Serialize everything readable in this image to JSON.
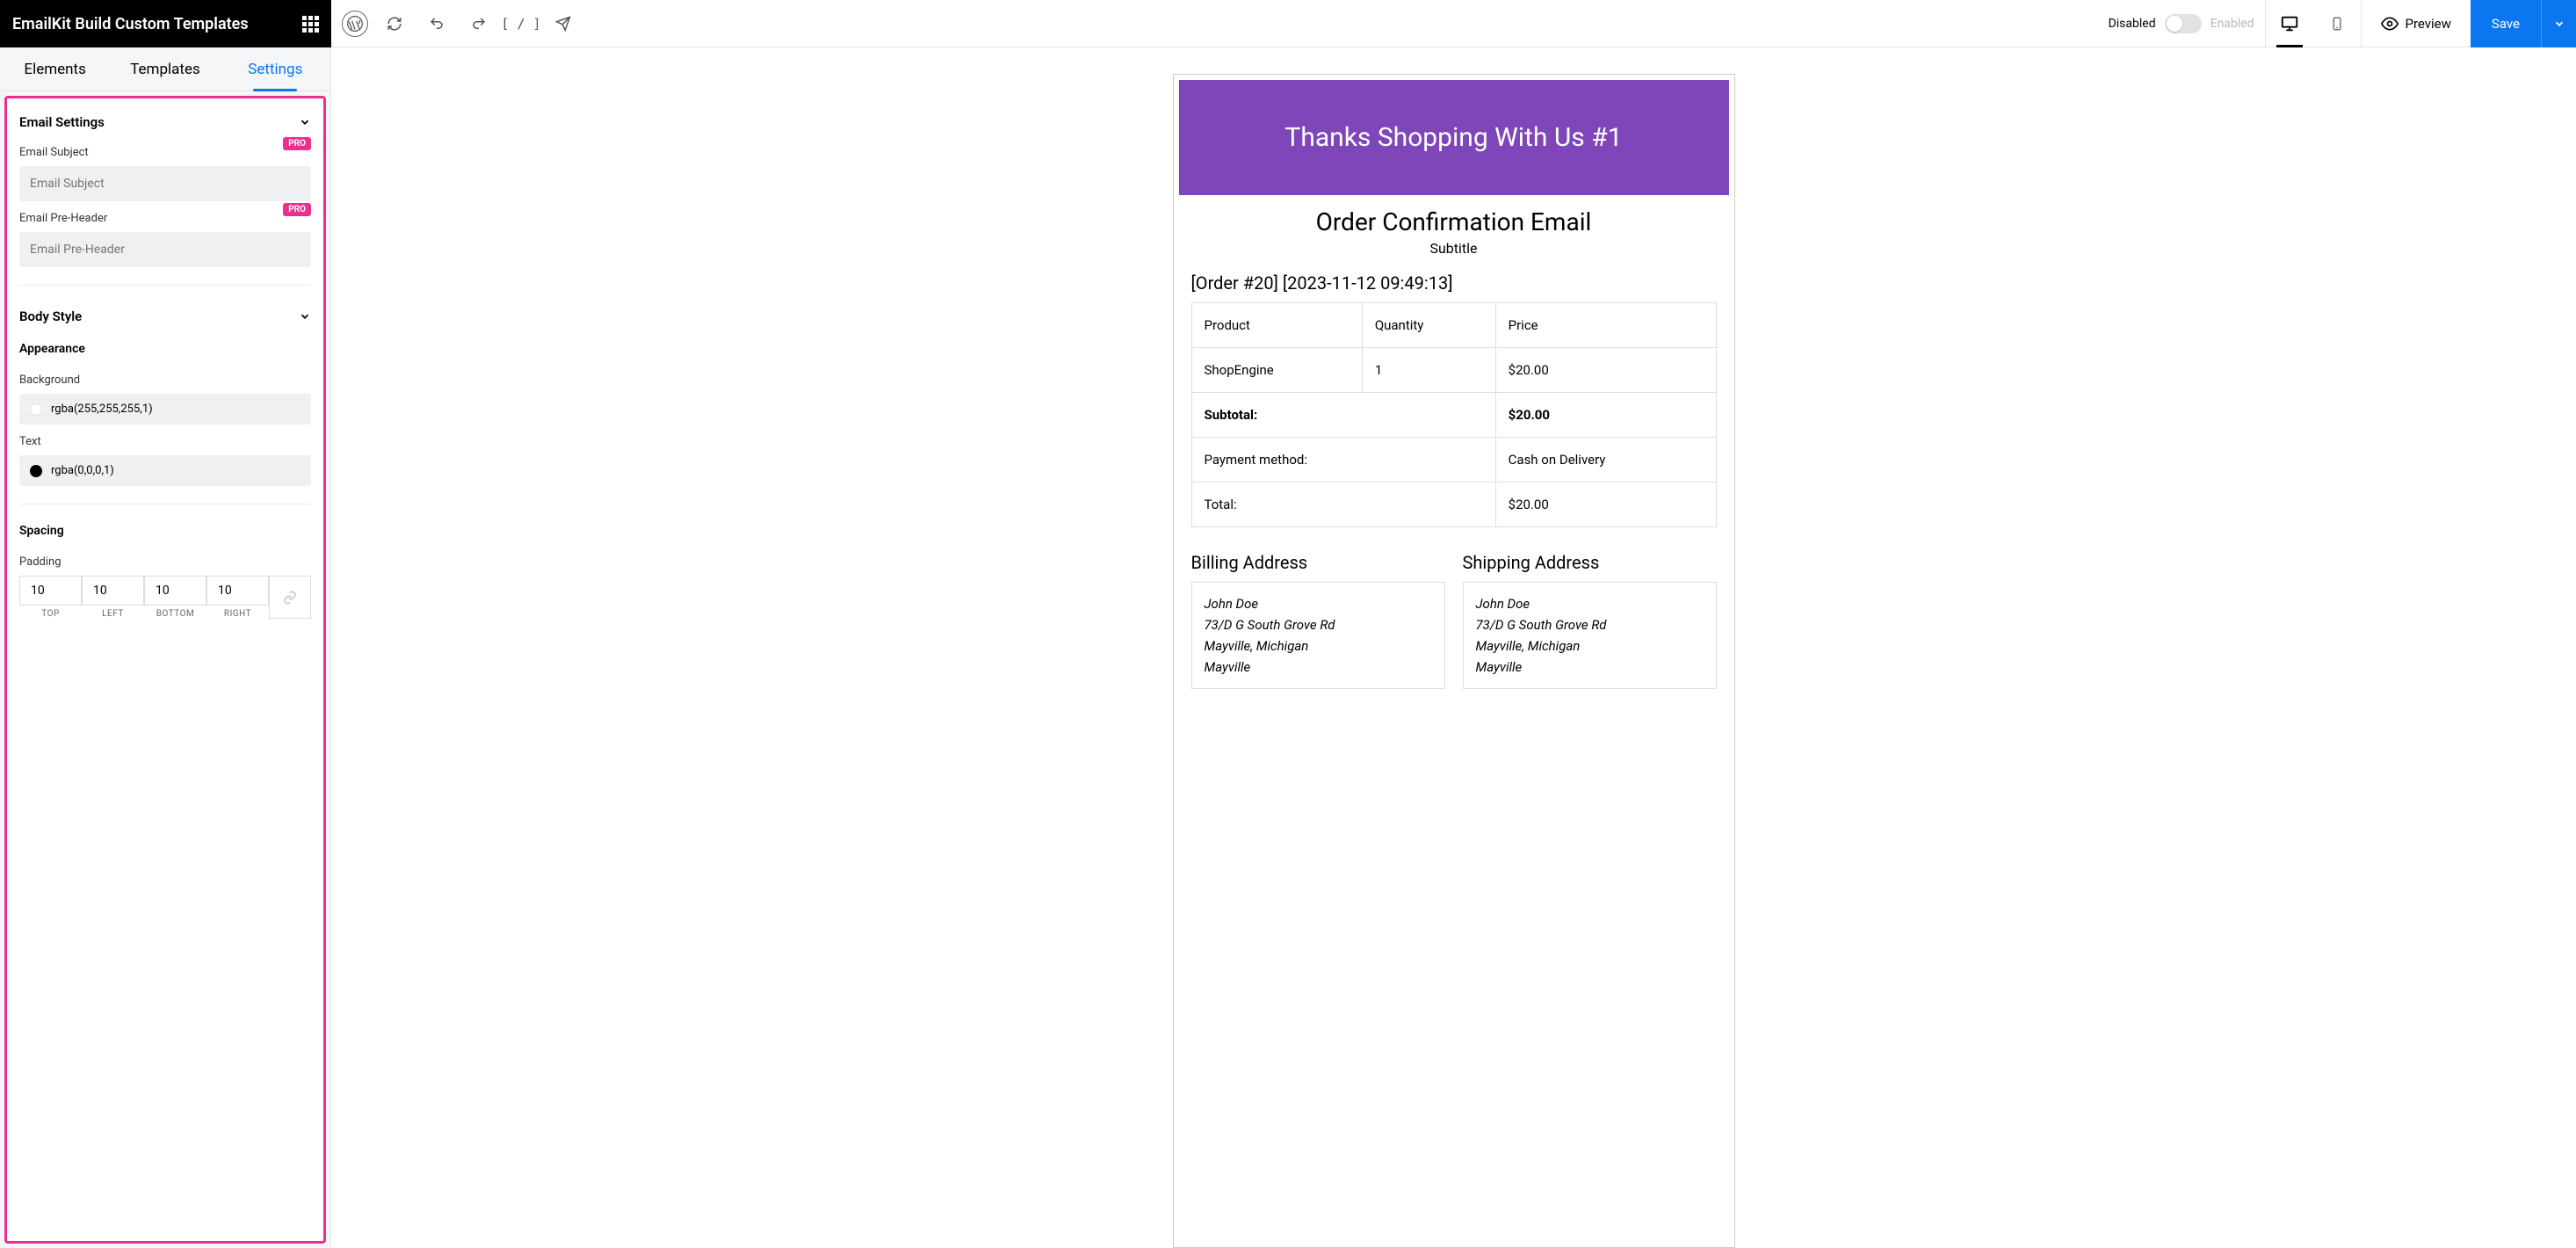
{
  "brand": "EmailKit Build Custom Templates",
  "topbar": {
    "disabled_label": "Disabled",
    "enabled_label": "Enabled",
    "preview_label": "Preview",
    "save_label": "Save"
  },
  "side_tabs": {
    "elements": "Elements",
    "templates": "Templates",
    "settings": "Settings"
  },
  "settings": {
    "email_section": "Email Settings",
    "subject_label": "Email Subject",
    "subject_placeholder": "Email Subject",
    "preheader_label": "Email Pre-Header",
    "preheader_placeholder": "Email Pre-Header",
    "pro_badge": "PRO",
    "body_section": "Body Style",
    "appearance": "Appearance",
    "background_label": "Background",
    "background_value": "rgba(255,255,255,1)",
    "text_label": "Text",
    "text_value": "rgba(0,0,0,1)",
    "spacing": "Spacing",
    "padding_label": "Padding",
    "padding": {
      "top": "10",
      "left": "10",
      "bottom": "10",
      "right": "10"
    },
    "padding_labels": {
      "top": "TOP",
      "left": "LEFT",
      "bottom": "BOTTOM",
      "right": "RIGHT"
    }
  },
  "email": {
    "hero": "Thanks Shopping With Us #1",
    "title": "Order Confirmation Email",
    "subtitle": "Subtitle",
    "order_meta": "[Order #20] [2023-11-12 09:49:13]",
    "headers": {
      "product": "Product",
      "qty": "Quantity",
      "price": "Price"
    },
    "item": {
      "product": "ShopEngine",
      "qty": "1",
      "price": "$20.00"
    },
    "subtotal_label": "Subtotal:",
    "subtotal": "$20.00",
    "payment_label": "Payment method:",
    "payment": "Cash on Delivery",
    "total_label": "Total:",
    "total": "$20.00",
    "billing_title": "Billing Address",
    "shipping_title": "Shipping Address",
    "addr": {
      "name": "John Doe",
      "street": "73/D G South Grove Rd",
      "city": "Mayville, Michigan",
      "town": "Mayville"
    }
  }
}
